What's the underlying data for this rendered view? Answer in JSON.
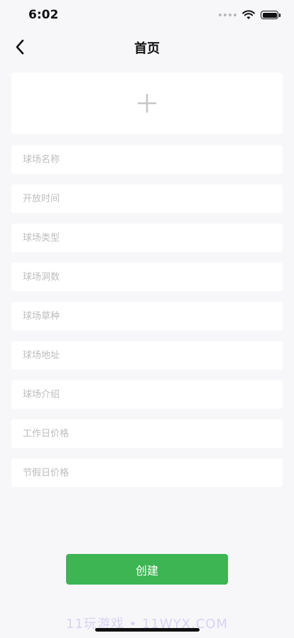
{
  "status_bar": {
    "time": "6:02"
  },
  "nav": {
    "title": "首页"
  },
  "form": {
    "fields": [
      {
        "placeholder": "球场名称"
      },
      {
        "placeholder": "开放时间"
      },
      {
        "placeholder": "球场类型"
      },
      {
        "placeholder": "球场洞数"
      },
      {
        "placeholder": "球场草种"
      },
      {
        "placeholder": "球场地址"
      },
      {
        "placeholder": "球场介绍"
      },
      {
        "placeholder": "工作日价格"
      },
      {
        "placeholder": "节假日价格"
      }
    ],
    "submit_label": "创建"
  },
  "watermark": "11玩游戏 • 11WYX.COM",
  "colors": {
    "accent": "#3cb552",
    "background": "#f7f7fa"
  },
  "icons": {
    "back": "chevron-left-icon",
    "add": "plus-icon"
  }
}
